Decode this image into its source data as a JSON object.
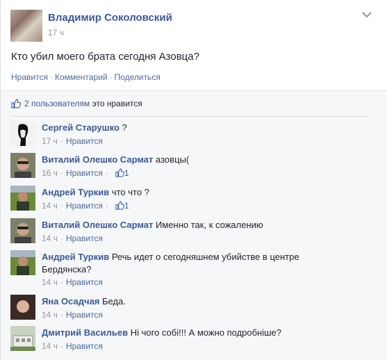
{
  "post": {
    "author": "Владимир Соколовский",
    "time": "17 ч",
    "text": "Кто убил моего брата сегодня Азовца?",
    "actions": [
      "Нравится",
      "Комментарий",
      "Поделиться"
    ]
  },
  "likes": {
    "count": "2",
    "users_word": "пользователям",
    "suffix": "это нравится"
  },
  "comments": [
    {
      "author": "Сергей Старушко",
      "text": "?",
      "time": "17 ч",
      "like_label": "Нравится",
      "like_count": ""
    },
    {
      "author": "Виталий Олешко Сармат",
      "text": "азовцы(",
      "time": "16 ч",
      "like_label": "Нравится",
      "like_count": "1"
    },
    {
      "author": "Андрей Туркив",
      "text": "что что ?",
      "time": "14 ч",
      "like_label": "Нравится",
      "like_count": "1"
    },
    {
      "author": "Виталий Олешко Сармат",
      "text": "Именно так, к сожалению",
      "time": "14 ч",
      "like_label": "Нравится",
      "like_count": ""
    },
    {
      "author": "Андрей Туркив",
      "text": "Речь идет о сегодняшнем убийстве в центре Бердянска?",
      "time": "14 ч",
      "like_label": "Нравится",
      "like_count": ""
    },
    {
      "author": "Яна Осадчая",
      "text": "Беда.",
      "time": "14 ч",
      "like_label": "Нравится",
      "like_count": ""
    },
    {
      "author": "Дмитрий Васильев",
      "text": "Ні чого собі!!! А можно подробніше?",
      "time": "14 ч",
      "like_label": "Нравится",
      "like_count": ""
    }
  ],
  "icons": {
    "post_menu": "chevron-down-icon",
    "like": "thumbs-up-icon"
  },
  "colors": {
    "link": "#3b5998",
    "meta": "#90949c",
    "background": "#f6f7f9"
  }
}
